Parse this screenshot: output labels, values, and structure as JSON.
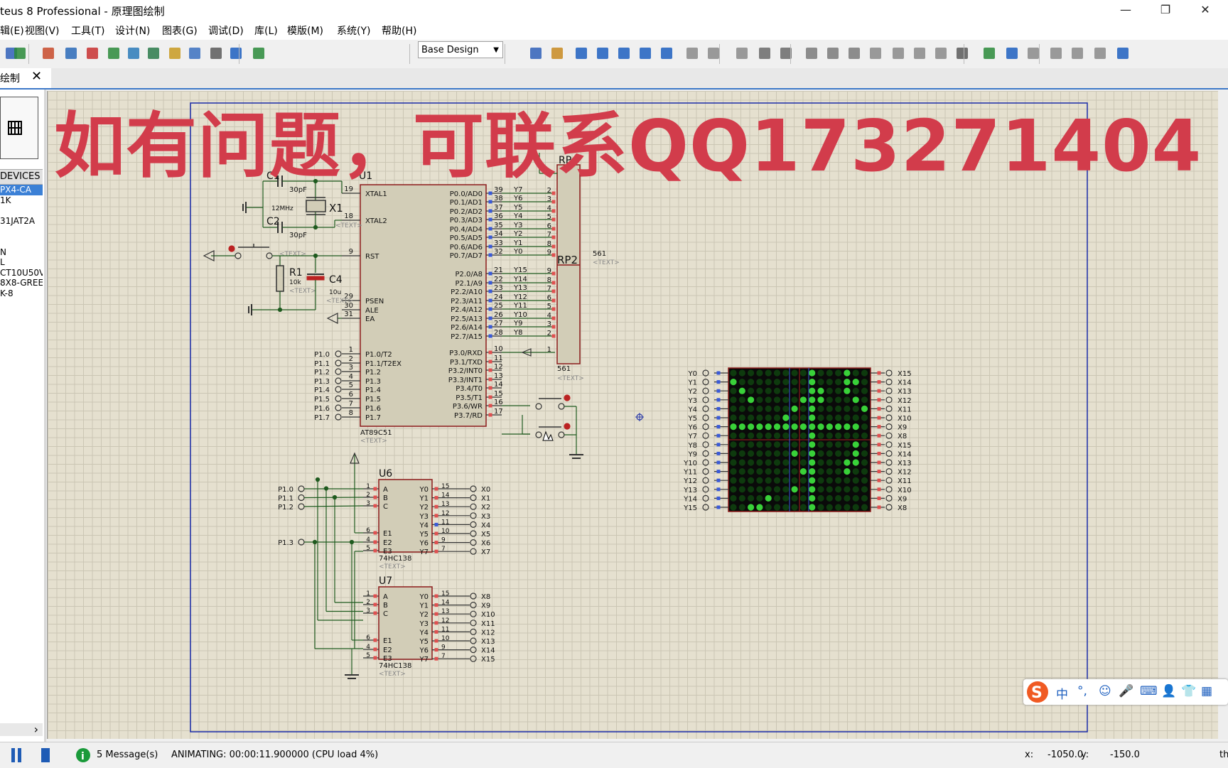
{
  "window": {
    "title": "teus 8 Professional - 原理图绘制",
    "minimize": "—",
    "maximize": "❐",
    "close": "✕"
  },
  "menu": [
    "辑(E)",
    "视图(V)",
    "工具(T)",
    "设计(N)",
    "图表(G)",
    "调试(D)",
    "库(L)",
    "模版(M)",
    "系统(Y)",
    "帮助(H)"
  ],
  "toolbar": {
    "design_select": "Base Design",
    "icons": [
      "save-icon",
      "import-icon",
      "home-icon",
      "netlist-icon",
      "chip-icon",
      "simulate-icon",
      "zoom-icon",
      "pcb-icon",
      "bom-icon",
      "binary-icon",
      "document-icon",
      "help-icon",
      "refresh-icon",
      "grid-icon",
      "origin-icon",
      "pan-icon",
      "zoom-in-icon",
      "zoom-out-icon",
      "zoom-all-icon",
      "zoom-area-icon",
      "undo-icon",
      "redo-icon",
      "cut-icon",
      "copy-icon",
      "paste-icon",
      "block-copy-icon",
      "block-move-icon",
      "block-rotate-icon",
      "block-delete-icon",
      "pick-device-icon",
      "make-device-icon",
      "decompose-icon",
      "wire-autoroute-icon",
      "property-icon",
      "search-tag-icon",
      "property-assign-icon",
      "new-sheet-icon",
      "remove-sheet-icon",
      "goto-sheet-icon",
      "design-explorer-icon"
    ]
  },
  "tab": {
    "label": "绘制",
    "close": "✕"
  },
  "left_panel": {
    "header": "DEVICES",
    "items": [
      "PX4-CA",
      "1K",
      "",
      "31JAT2A",
      "",
      "",
      "N",
      "L",
      "CT10U50V",
      "8X8-GREEN",
      "K-8"
    ],
    "scroll_right": "›"
  },
  "overlay_text": "如有问题，可联系QQ173271404",
  "schematic": {
    "u1": {
      "ref": "U1",
      "part": "AT89C51",
      "text": "<TEXT>",
      "left_pins": [
        {
          "num": "19",
          "name": "XTAL1"
        },
        {
          "num": "18",
          "name": "XTAL2"
        },
        {
          "num": "9",
          "name": "RST"
        },
        {
          "num": "29",
          "name": "PSEN"
        },
        {
          "num": "30",
          "name": "ALE"
        },
        {
          "num": "31",
          "name": "EA"
        },
        {
          "num": "1",
          "name": "P1.0/T2"
        },
        {
          "num": "2",
          "name": "P1.1/T2EX"
        },
        {
          "num": "3",
          "name": "P1.2"
        },
        {
          "num": "4",
          "name": "P1.3"
        },
        {
          "num": "5",
          "name": "P1.4"
        },
        {
          "num": "6",
          "name": "P1.5"
        },
        {
          "num": "7",
          "name": "P1.6"
        },
        {
          "num": "8",
          "name": "P1.7"
        }
      ],
      "p1_labels": [
        "P1.0",
        "P1.1",
        "P1.2",
        "P1.3",
        "P1.4",
        "P1.5",
        "P1.6",
        "P1.7"
      ],
      "right_pins": [
        {
          "num": "39",
          "name": "P0.0/AD0",
          "net": "Y7",
          "rp": "2"
        },
        {
          "num": "38",
          "name": "P0.1/AD1",
          "net": "Y6",
          "rp": "3"
        },
        {
          "num": "37",
          "name": "P0.2/AD2",
          "net": "Y5",
          "rp": "4"
        },
        {
          "num": "36",
          "name": "P0.3/AD3",
          "net": "Y4",
          "rp": "5"
        },
        {
          "num": "35",
          "name": "P0.4/AD4",
          "net": "Y3",
          "rp": "6"
        },
        {
          "num": "34",
          "name": "P0.5/AD5",
          "net": "Y2",
          "rp": "7"
        },
        {
          "num": "33",
          "name": "P0.6/AD6",
          "net": "Y1",
          "rp": "8"
        },
        {
          "num": "32",
          "name": "P0.7/AD7",
          "net": "Y0",
          "rp": "9"
        },
        {
          "num": "21",
          "name": "P2.0/A8",
          "net": "Y15",
          "rp": "9"
        },
        {
          "num": "22",
          "name": "P2.1/A9",
          "net": "Y14",
          "rp": "8"
        },
        {
          "num": "23",
          "name": "P2.2/A10",
          "net": "Y13",
          "rp": "7"
        },
        {
          "num": "24",
          "name": "P2.3/A11",
          "net": "Y12",
          "rp": "6"
        },
        {
          "num": "25",
          "name": "P2.4/A12",
          "net": "Y11",
          "rp": "5"
        },
        {
          "num": "26",
          "name": "P2.5/A13",
          "net": "Y10",
          "rp": "4"
        },
        {
          "num": "27",
          "name": "P2.6/A14",
          "net": "Y9",
          "rp": "3"
        },
        {
          "num": "28",
          "name": "P2.7/A15",
          "net": "Y8",
          "rp": "2"
        },
        {
          "num": "10",
          "name": "P3.0/RXD",
          "net": "",
          "rp": "1"
        },
        {
          "num": "11",
          "name": "P3.1/TXD",
          "net": "",
          "rp": ""
        },
        {
          "num": "12",
          "name": "P3.2/INT0",
          "net": "",
          "rp": ""
        },
        {
          "num": "13",
          "name": "P3.3/INT1",
          "net": "",
          "rp": ""
        },
        {
          "num": "14",
          "name": "P3.4/T0",
          "net": "",
          "rp": ""
        },
        {
          "num": "15",
          "name": "P3.5/T1",
          "net": "",
          "rp": ""
        },
        {
          "num": "16",
          "name": "P3.6/WR",
          "net": "",
          "rp": ""
        },
        {
          "num": "17",
          "name": "P3.7/RD",
          "net": "",
          "rp": ""
        }
      ]
    },
    "c1": {
      "ref": "C1",
      "value": "30pF"
    },
    "c2": {
      "ref": "C2",
      "value": "30pF"
    },
    "x1": {
      "ref": "X1",
      "value": "12MHz",
      "text": "<TEXT>"
    },
    "r1": {
      "ref": "R1",
      "value": "10k",
      "text": "<TEXT>"
    },
    "c4": {
      "ref": "C4",
      "value": "10u",
      "text": "<TEXT>"
    },
    "rp1": {
      "ref": "RP",
      "pin1": "1"
    },
    "rp2": {
      "ref": "RP2",
      "value": "561",
      "text": "<TEXT>",
      "value2": "561",
      "text2": "<TEXT>"
    },
    "reset_text": "<TEXT>",
    "u6": {
      "ref": "U6",
      "part": "74HC138",
      "text": "<TEXT>",
      "in_pins": [
        {
          "num": "1",
          "name": "A"
        },
        {
          "num": "2",
          "name": "B"
        },
        {
          "num": "3",
          "name": "C"
        },
        {
          "num": "6",
          "name": "E1"
        },
        {
          "num": "4",
          "name": "E2"
        },
        {
          "num": "5",
          "name": "E3"
        }
      ],
      "out_pins": [
        {
          "num": "15",
          "name": "Y0",
          "net": "X0"
        },
        {
          "num": "14",
          "name": "Y1",
          "net": "X1"
        },
        {
          "num": "13",
          "name": "Y2",
          "net": "X2"
        },
        {
          "num": "12",
          "name": "Y3",
          "net": "X3"
        },
        {
          "num": "11",
          "name": "Y4",
          "net": "X4"
        },
        {
          "num": "10",
          "name": "Y5",
          "net": "X5"
        },
        {
          "num": "9",
          "name": "Y6",
          "net": "X6"
        },
        {
          "num": "7",
          "name": "Y7",
          "net": "X7"
        }
      ],
      "labels": [
        "P1.0",
        "P1.1",
        "P1.2",
        "P1.3"
      ]
    },
    "u7": {
      "ref": "U7",
      "part": "74HC138",
      "text": "<TEXT>",
      "in_pins": [
        {
          "num": "1",
          "name": "A"
        },
        {
          "num": "2",
          "name": "B"
        },
        {
          "num": "3",
          "name": "C"
        },
        {
          "num": "6",
          "name": "E1"
        },
        {
          "num": "4",
          "name": "E2"
        },
        {
          "num": "5",
          "name": "E3"
        }
      ],
      "out_pins": [
        {
          "num": "15",
          "name": "Y0",
          "net": "X8"
        },
        {
          "num": "14",
          "name": "Y1",
          "net": "X9"
        },
        {
          "num": "13",
          "name": "Y2",
          "net": "X10"
        },
        {
          "num": "12",
          "name": "Y3",
          "net": "X11"
        },
        {
          "num": "11",
          "name": "Y4",
          "net": "X12"
        },
        {
          "num": "10",
          "name": "Y5",
          "net": "X13"
        },
        {
          "num": "9",
          "name": "Y6",
          "net": "X14"
        },
        {
          "num": "7",
          "name": "Y7",
          "net": "X15"
        }
      ]
    },
    "matrix": {
      "left_labels": [
        "Y0",
        "Y1",
        "Y2",
        "Y3",
        "Y4",
        "Y5",
        "Y6",
        "Y7",
        "Y8",
        "Y9",
        "Y10",
        "Y11",
        "Y12",
        "Y13",
        "Y14",
        "Y15"
      ],
      "right_labels": [
        "X15",
        "X14",
        "X13",
        "X12",
        "X11",
        "X10",
        "X9",
        "X8",
        "X15",
        "X14",
        "X13",
        "X12",
        "X11",
        "X10",
        "X9",
        "X8"
      ],
      "lit_rows": [
        "0000000001000100",
        "1000000001000110",
        "0100000001100100",
        "0010000011100010",
        "0000000101000001",
        "0000001001000000",
        "1111111111111110",
        "0000000001000000",
        "0000000001000010",
        "0000000101000010",
        "0000000001000110",
        "0000000011000100",
        "0000000001000000",
        "0000000101000000",
        "0000100001000000",
        "0011000001000000"
      ]
    }
  },
  "status": {
    "messages": "5 Message(s)",
    "animating": "ANIMATING: 00:00:11.900000 (CPU load 4%)",
    "x_label": "x:",
    "x_value": "-1050.0",
    "y_label": "y:",
    "y_value": "-150.0",
    "th": "th"
  },
  "ime": [
    "中",
    "°,",
    "☺",
    "🎤",
    "⌨",
    "👤",
    "👕",
    "▦"
  ]
}
